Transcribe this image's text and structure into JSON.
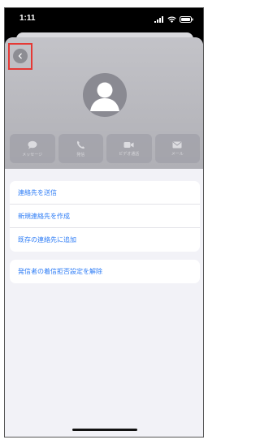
{
  "status_bar": {
    "time": "1:11",
    "icons": [
      "signal-icon",
      "wifi-icon",
      "battery-icon"
    ]
  },
  "header": {
    "back_icon": "chevron-left-icon",
    "avatar_icon": "person-silhouette-icon"
  },
  "actions": [
    {
      "label": "メッセージ",
      "icon": "message-icon"
    },
    {
      "label": "発信",
      "icon": "phone-icon"
    },
    {
      "label": "ビデオ通話",
      "icon": "video-icon"
    },
    {
      "label": "メール",
      "icon": "mail-icon"
    }
  ],
  "contact_options": [
    {
      "label": "連絡先を送信"
    },
    {
      "label": "新規連絡先を作成"
    },
    {
      "label": "既存の連絡先に追加"
    }
  ],
  "block_options": [
    {
      "label": "発信者の着信拒否設定を解除"
    }
  ],
  "colors": {
    "link": "#2d7cf6",
    "highlight_box": "#e53935"
  }
}
